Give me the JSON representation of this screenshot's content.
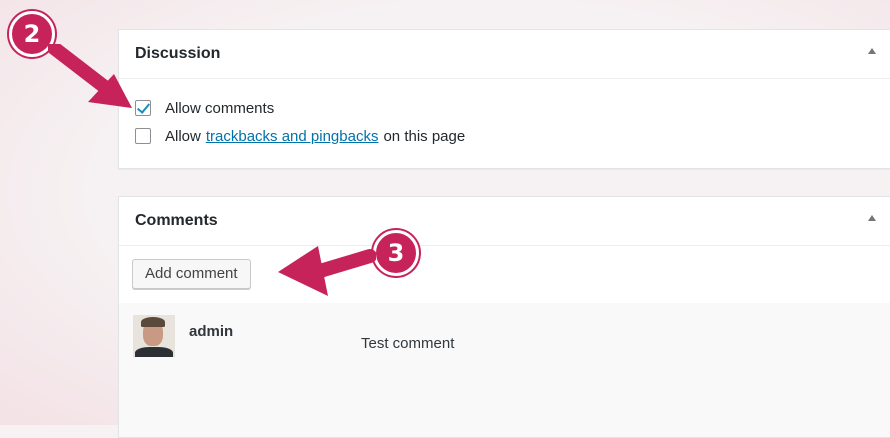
{
  "discussion": {
    "title": "Discussion",
    "options": [
      {
        "prefix": "Allow comments",
        "checked": true
      },
      {
        "prefix": "Allow",
        "link": "trackbacks and pingbacks",
        "suffix": "on this page",
        "checked": false
      }
    ]
  },
  "comments": {
    "title": "Comments",
    "add_button": "Add comment",
    "items": [
      {
        "author": "admin",
        "text": "Test comment"
      }
    ]
  },
  "annotations": {
    "badge_discussion": "2",
    "badge_comments": "3",
    "accent": "#c7235b"
  }
}
